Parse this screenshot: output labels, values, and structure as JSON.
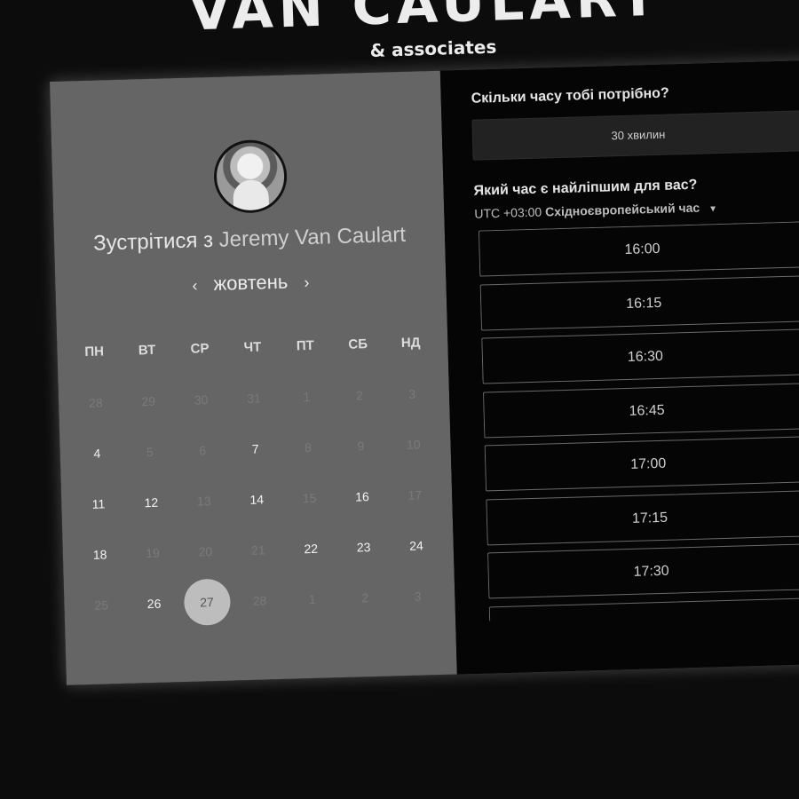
{
  "brand": {
    "title": "VAN CAULART",
    "subtitle": "& associates"
  },
  "left": {
    "meet_prefix": "Зустрітися з",
    "meet_name": "Jeremy Van Caulart",
    "month": "жовтень",
    "prev_icon": "‹",
    "next_icon": "›",
    "weekdays": [
      "ПН",
      "ВТ",
      "СР",
      "ЧТ",
      "ПТ",
      "СБ",
      "НД"
    ],
    "days": [
      {
        "n": "28",
        "state": "muted"
      },
      {
        "n": "29",
        "state": "muted"
      },
      {
        "n": "30",
        "state": "muted"
      },
      {
        "n": "31",
        "state": "muted"
      },
      {
        "n": "1",
        "state": "muted"
      },
      {
        "n": "2",
        "state": "muted"
      },
      {
        "n": "3",
        "state": "muted"
      },
      {
        "n": "4",
        "state": "avail"
      },
      {
        "n": "5",
        "state": "muted"
      },
      {
        "n": "6",
        "state": "muted"
      },
      {
        "n": "7",
        "state": "avail"
      },
      {
        "n": "8",
        "state": "muted"
      },
      {
        "n": "9",
        "state": "muted"
      },
      {
        "n": "10",
        "state": "muted"
      },
      {
        "n": "11",
        "state": "avail"
      },
      {
        "n": "12",
        "state": "avail"
      },
      {
        "n": "13",
        "state": "muted"
      },
      {
        "n": "14",
        "state": "avail"
      },
      {
        "n": "15",
        "state": "muted"
      },
      {
        "n": "16",
        "state": "avail"
      },
      {
        "n": "17",
        "state": "muted"
      },
      {
        "n": "18",
        "state": "avail"
      },
      {
        "n": "19",
        "state": "muted"
      },
      {
        "n": "20",
        "state": "muted"
      },
      {
        "n": "21",
        "state": "muted"
      },
      {
        "n": "22",
        "state": "avail"
      },
      {
        "n": "23",
        "state": "avail"
      },
      {
        "n": "24",
        "state": "avail"
      },
      {
        "n": "25",
        "state": "muted"
      },
      {
        "n": "26",
        "state": "avail"
      },
      {
        "n": "27",
        "state": "selected"
      },
      {
        "n": "28",
        "state": "muted"
      },
      {
        "n": "1",
        "state": "muted"
      },
      {
        "n": "2",
        "state": "muted"
      },
      {
        "n": "3",
        "state": "muted"
      }
    ]
  },
  "right": {
    "duration_question": "Скільки часу тобі потрібно?",
    "duration_value": "30 хвилин",
    "time_question": "Який час є найліпшим для вас?",
    "tz_offset": "UTC +03:00",
    "tz_name": "Східноєвропейський час",
    "slots": [
      "16:00",
      "16:15",
      "16:30",
      "16:45",
      "17:00",
      "17:15",
      "17:30",
      ""
    ]
  },
  "colors": {
    "panel_left": "#656565",
    "panel_right": "#050505",
    "selected": "#bdbdbd"
  },
  "icons": {
    "avatar": "avatar",
    "tz_caret": "caret-down-icon"
  }
}
